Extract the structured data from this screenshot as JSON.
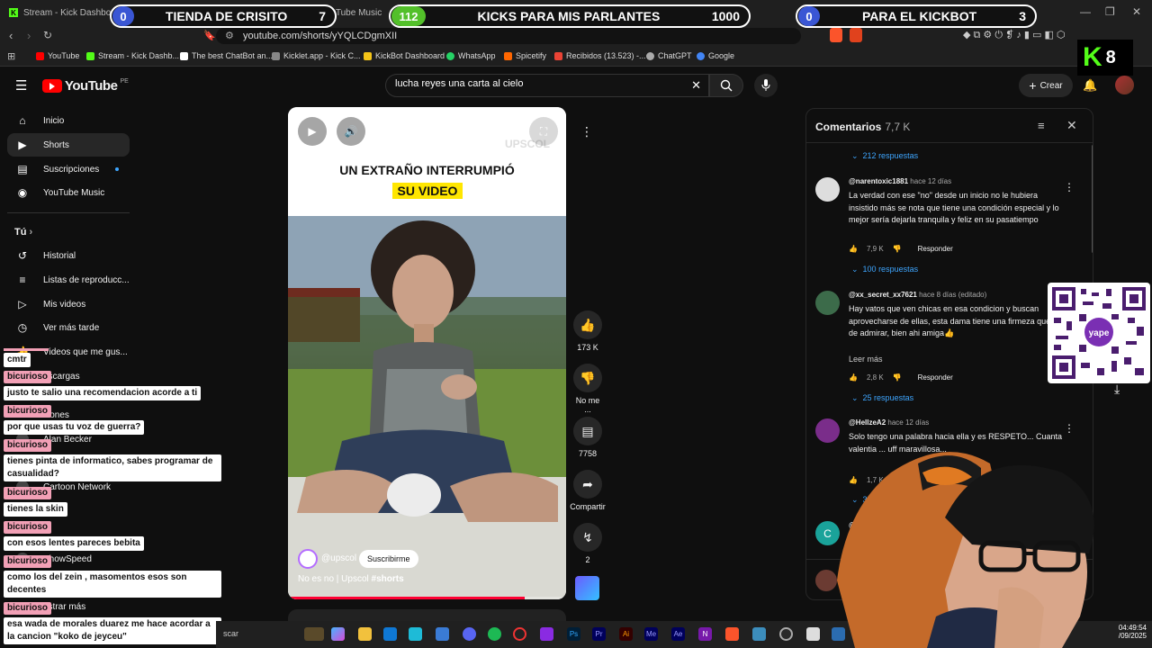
{
  "browser": {
    "tabs": [
      {
        "label": "Stream - Kick Dashboard"
      },
      {
        "label": "YouTube Music"
      }
    ],
    "url": "youtube.com/shorts/yYQLCDgmXII",
    "bookmarks": [
      {
        "label": "YouTube",
        "color": "#ff0000"
      },
      {
        "label": "Stream - Kick Dashb...",
        "color": "#53fc18"
      },
      {
        "label": "The best ChatBot an...",
        "color": "#ffffff"
      },
      {
        "label": "Kicklet.app - Kick C...",
        "color": "#888888"
      },
      {
        "label": "KickBot Dashboard",
        "color": "#f5c518"
      },
      {
        "label": "WhatsApp",
        "color": "#25d366"
      },
      {
        "label": "Spicetify",
        "color": "#ff6600"
      },
      {
        "label": "Recibidos (13.523) -...",
        "color": "#ea4335"
      },
      {
        "label": "ChatGPT",
        "color": "#aaaaaa"
      },
      {
        "label": "Google",
        "color": "#4285f4"
      }
    ]
  },
  "overlays": {
    "goals": [
      {
        "count": "0",
        "title": "TIENDA DE CRISITO",
        "target": "7",
        "badge_color": "#3a56d4"
      },
      {
        "count": "112",
        "title": "KICKS PARA MIS PARLANTES",
        "target": "1000",
        "badge_color": "#53c02a"
      },
      {
        "count": "0",
        "title": "PARA EL KICKBOT",
        "target": "3",
        "badge_color": "#3a56d4"
      }
    ],
    "kick_viewers": "8"
  },
  "youtube": {
    "logo_text": "YouTube",
    "logo_region": "PE",
    "search_value": "lucha reyes una carta al cielo",
    "create_label": "Crear",
    "sidebar": {
      "main": [
        {
          "label": "Inicio",
          "icon": "home-icon"
        },
        {
          "label": "Shorts",
          "icon": "shorts-icon"
        },
        {
          "label": "Suscripciones",
          "icon": "subscriptions-icon"
        },
        {
          "label": "YouTube Music",
          "icon": "music-icon"
        }
      ],
      "you_label": "Tú",
      "you": [
        {
          "label": "Historial"
        },
        {
          "label": "Listas de reproducc..."
        },
        {
          "label": "Mis videos"
        },
        {
          "label": "Ver más tarde"
        },
        {
          "label": "Videos que me gus..."
        },
        {
          "label": "escargas"
        },
        {
          "label": "ciones"
        }
      ],
      "subs": [
        {
          "label": "Alan Becker"
        },
        {
          "label": "Cartoon Network"
        },
        {
          "label": "au5"
        },
        {
          "label": "ShowSpeed"
        },
        {
          "label": "ostrar más"
        }
      ]
    },
    "short": {
      "title_line1": "UN EXTRAÑO INTERRUMPIÓ",
      "title_line2": "SU VIDEO",
      "watermark": "UPSCOL",
      "channel": "@upscol",
      "subscribe_label": "Suscribirme",
      "description": "No es no | Upscol ",
      "hashtag": "#shorts",
      "progress": 0.85
    },
    "actions": {
      "likes": "173 K",
      "dislike_label": "No me ...",
      "comments": "7758",
      "share_label": "Compartir",
      "remix": "2"
    },
    "comments_panel": {
      "title": "Comentarios",
      "count": "7,7 K",
      "reply_label": "Responder",
      "top_replies": "212 respuestas",
      "items": [
        {
          "author": "@narentoxic1881",
          "time": "hace 12 días",
          "text": "La verdad con ese \"no\" desde un inicio no le hubiera insistido más se nota que tiene una condición especial y lo mejor sería dejarla tranquila y feliz en su pasatiempo",
          "likes": "7,9 K",
          "replies": "100 respuestas",
          "avatar_color": "#dddddd"
        },
        {
          "author": "@xx_secret_xx7621",
          "time": "hace 8 días (editado)",
          "text": "Hay vatos que ven chicas en esa condicion y buscan aprovecharse de ellas, esta dama tiene una firmeza que es de admirar, bien ahi amiga👍",
          "more": "Leer más",
          "likes": "2,8 K",
          "replies": "25 respuestas",
          "avatar_color": "#3c6b4a"
        },
        {
          "author": "@HellzeA2",
          "time": "hace 12 días",
          "text": "Solo tengo una palabra hacia ella y es RESPETO... Cuanta valentia ... uff maravillosa...",
          "likes": "1,7 K",
          "replies": "32 r...",
          "avatar_color": "#7a2d8a"
        },
        {
          "author": "@c...",
          "time": "",
          "text": "",
          "avatar_letter": "C",
          "avatar_color": "#1aa39a"
        }
      ]
    }
  },
  "chat": [
    {
      "user": "",
      "message": "cmtr"
    },
    {
      "user": "bicurioso",
      "message": "justo te salio una recomendacion acorde a ti"
    },
    {
      "user": "bicurioso",
      "message": "por que usas tu voz de guerra?"
    },
    {
      "user": "bicurioso",
      "message": "tienes pinta de informatico, sabes programar de casualidad?"
    },
    {
      "user": "bicurioso",
      "message": "tienes la skin"
    },
    {
      "user": "bicurioso",
      "message": "con esos lentes pareces bebita"
    },
    {
      "user": "bicurioso",
      "message": "como los del zein , masomentos esos son decentes"
    },
    {
      "user": "bicurioso",
      "message": "esa wada de morales duarez me hace acordar a la cancion \"koko de jeyceu\""
    }
  ],
  "taskbar": {
    "search_text": "scar",
    "time": "04:49:54",
    "date": "/09/2025"
  },
  "qr": {
    "brand": "yape"
  }
}
